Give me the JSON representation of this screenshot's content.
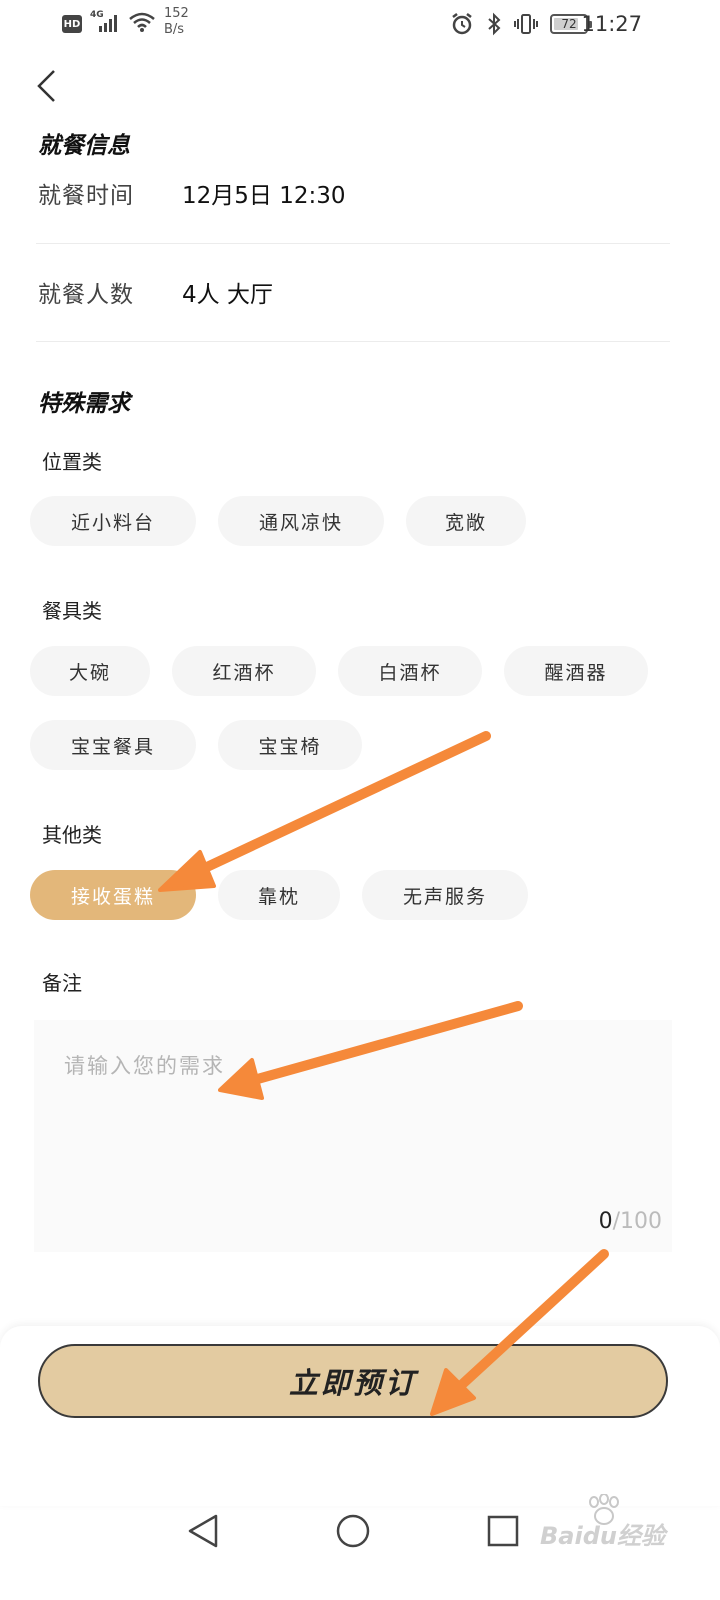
{
  "status_bar": {
    "hd": "HD",
    "network": "4G",
    "speed_value": "152",
    "speed_unit": "B/s",
    "battery": "72",
    "time": "11:27"
  },
  "dining_info": {
    "title": "就餐信息",
    "time_label": "就餐时间",
    "time_value": "12月5日  12:30",
    "people_label": "就餐人数",
    "people_value": "4人 大厅"
  },
  "special": {
    "title": "特殊需求",
    "location": {
      "label": "位置类",
      "options": [
        "近小料台",
        "通风凉快",
        "宽敞"
      ]
    },
    "tableware": {
      "label": "餐具类",
      "options": [
        "大碗",
        "红酒杯",
        "白酒杯",
        "醒酒器",
        "宝宝餐具",
        "宝宝椅"
      ]
    },
    "other": {
      "label": "其他类",
      "options": [
        "接收蛋糕",
        "靠枕",
        "无声服务"
      ],
      "selected": "接收蛋糕"
    }
  },
  "remark": {
    "label": "备注",
    "placeholder": "请输入您的需求",
    "count": "0",
    "max": "/100"
  },
  "book_button": "立即预订",
  "watermark": "Baidu经验",
  "colors": {
    "chip_bg": "#f5f5f5",
    "chip_selected": "#e3b77a",
    "button_bg": "#e3cba1",
    "annotation_arrow": "#f5893a"
  }
}
